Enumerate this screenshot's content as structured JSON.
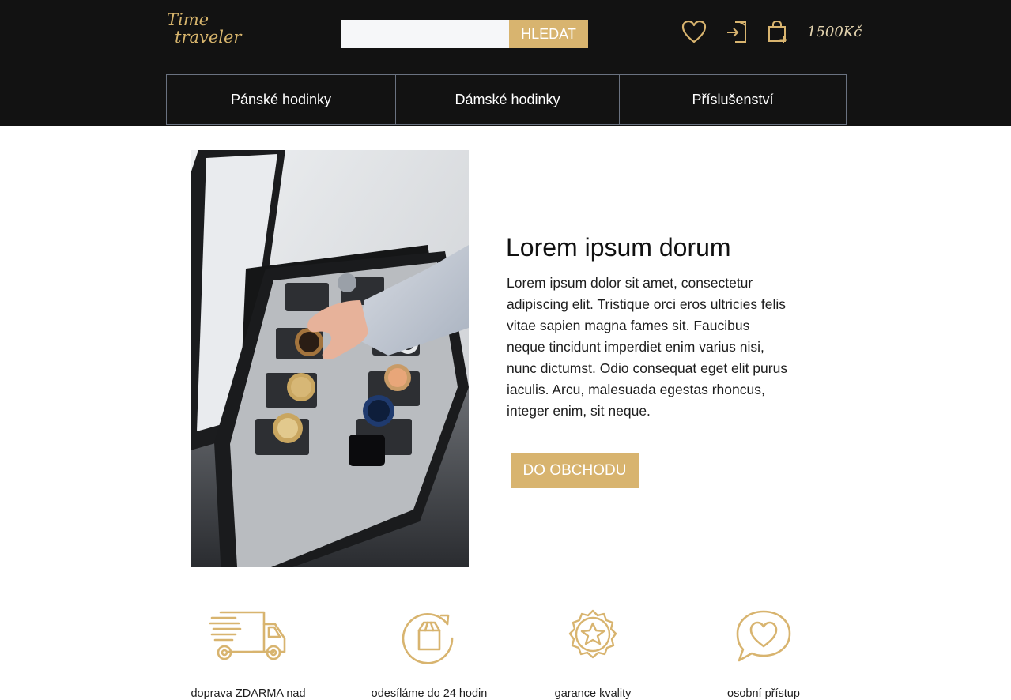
{
  "header": {
    "logo_line1": "Time",
    "logo_line2": "traveler",
    "search": {
      "value": "",
      "placeholder": "",
      "button_label": "HLEDAT"
    },
    "cart_total": "1500Kč",
    "nav": [
      "Pánské hodinky",
      "Dámské hodinky",
      "Příslušenství"
    ]
  },
  "icons": {
    "wishlist": "heart-icon",
    "login": "login-icon",
    "cart": "shopping-bag-icon"
  },
  "hero": {
    "image": "watch-box-photo",
    "title": "Lorem ipsum dorum",
    "text": "Lorem ipsum dolor sit amet, consectetur adipiscing elit. Tristique orci eros ultricies felis vitae sapien magna fames sit. Faucibus neque tincidunt imperdiet enim varius nisi, nunc dictumst. Odio consequat eget elit purus iaculis. Arcu, malesuada egestas rhoncus, integer enim, sit neque.",
    "button": "DO OBCHODU"
  },
  "features": [
    {
      "icon": "delivery-truck-icon",
      "label": "doprava ZDARMA nad"
    },
    {
      "icon": "box-refresh-icon",
      "label": "odesíláme do 24 hodin"
    },
    {
      "icon": "quality-badge-icon",
      "label": "garance kvality"
    },
    {
      "icon": "heart-chat-icon",
      "label": "osobní přístup"
    }
  ],
  "colors": {
    "header_bg": "#121212",
    "accent": "#d8b46f",
    "nav_border": "#6a7280",
    "search_bg": "#f6f7f9"
  }
}
